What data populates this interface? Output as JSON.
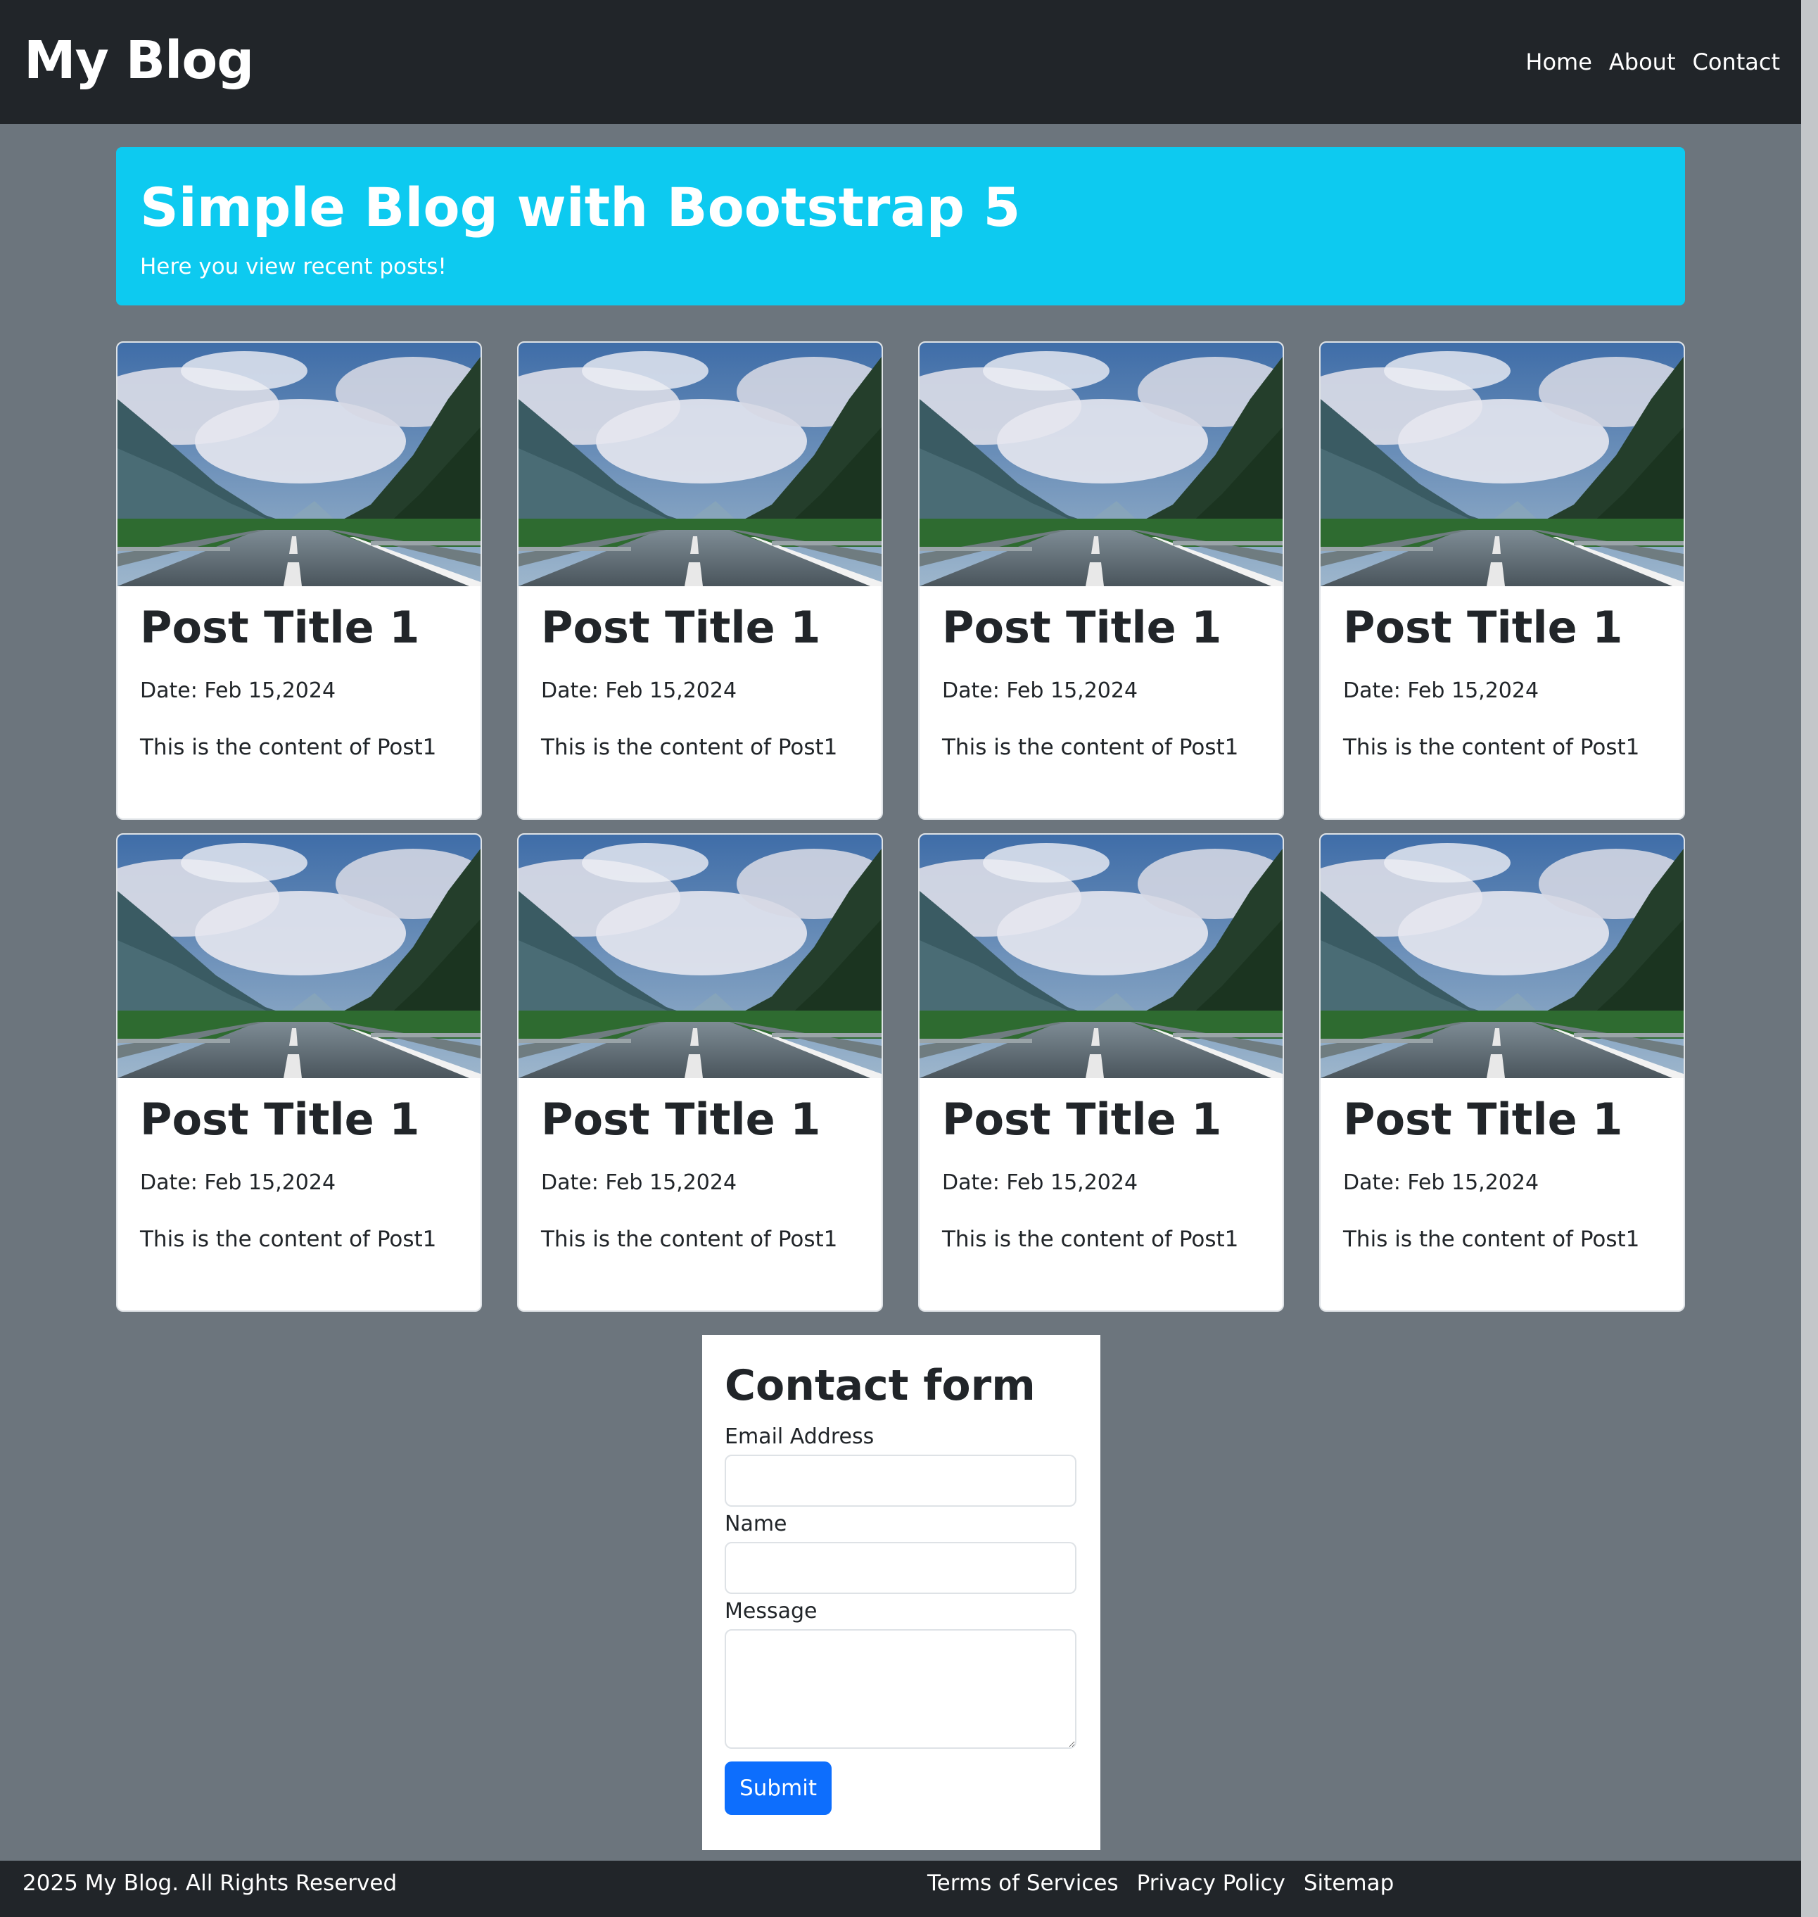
{
  "navbar": {
    "brand": "My Blog",
    "links": [
      "Home",
      "About",
      "Contact"
    ]
  },
  "hero": {
    "title": "Simple Blog with Bootstrap 5",
    "subtitle": "Here you view recent posts!"
  },
  "posts": [
    {
      "title": "Post Title 1",
      "date": "Date: Feb 15,2024",
      "content": "This is the content of Post1",
      "image": "mountain-road-landscape"
    },
    {
      "title": "Post Title 1",
      "date": "Date: Feb 15,2024",
      "content": "This is the content of Post1",
      "image": "mountain-road-landscape"
    },
    {
      "title": "Post Title 1",
      "date": "Date: Feb 15,2024",
      "content": "This is the content of Post1",
      "image": "mountain-road-landscape"
    },
    {
      "title": "Post Title 1",
      "date": "Date: Feb 15,2024",
      "content": "This is the content of Post1",
      "image": "mountain-road-landscape"
    },
    {
      "title": "Post Title 1",
      "date": "Date: Feb 15,2024",
      "content": "This is the content of Post1",
      "image": "mountain-road-landscape"
    },
    {
      "title": "Post Title 1",
      "date": "Date: Feb 15,2024",
      "content": "This is the content of Post1",
      "image": "mountain-road-landscape"
    },
    {
      "title": "Post Title 1",
      "date": "Date: Feb 15,2024",
      "content": "This is the content of Post1",
      "image": "mountain-road-landscape"
    },
    {
      "title": "Post Title 1",
      "date": "Date: Feb 15,2024",
      "content": "This is the content of Post1",
      "image": "mountain-road-landscape"
    }
  ],
  "contact": {
    "title": "Contact form",
    "email_label": "Email Address",
    "email_value": "",
    "name_label": "Name",
    "name_value": "",
    "message_label": "Message",
    "message_value": "",
    "submit_label": "Submit"
  },
  "footer": {
    "copyright": "2025 My Blog. All Rights Reserved",
    "links": [
      "Terms of Services",
      "Privacy Policy",
      "Sitemap"
    ]
  },
  "colors": {
    "navbar": "#212529",
    "page_background": "#6c757d",
    "hero": "#0dcaf0",
    "primary_button": "#0d6efd"
  }
}
